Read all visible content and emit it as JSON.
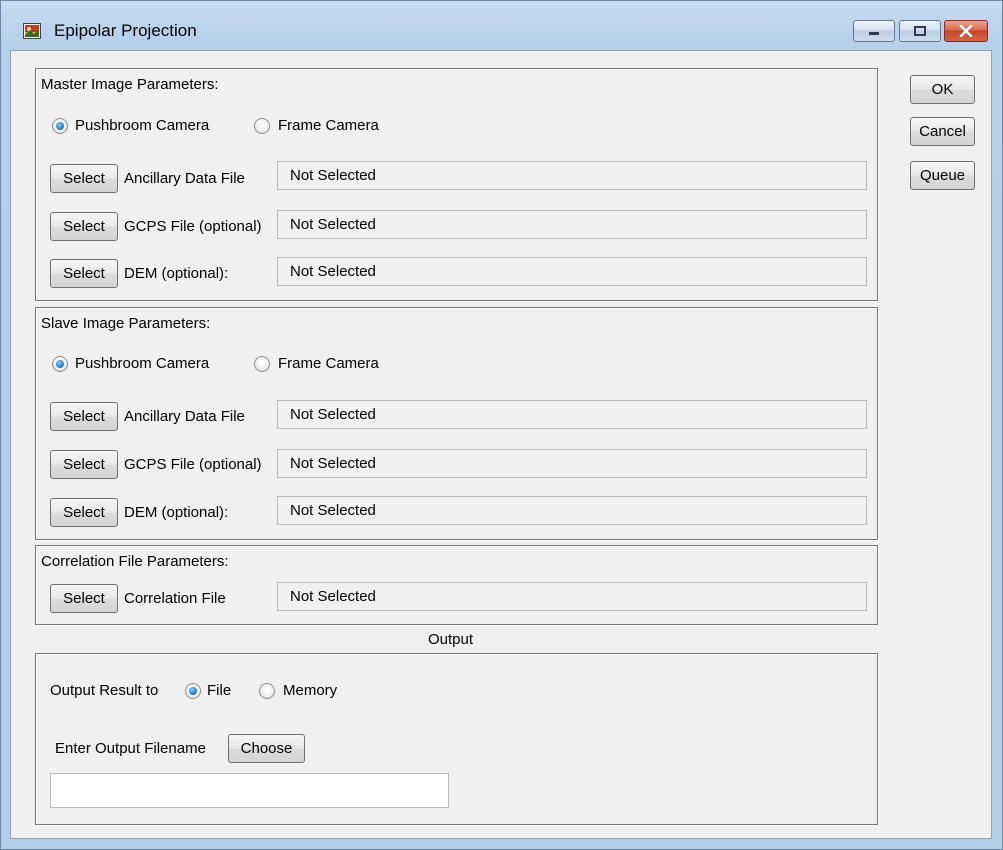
{
  "window": {
    "title": "Epipolar Projection",
    "controls": {
      "minimize": "minimize",
      "maximize": "maximize",
      "close": "close"
    }
  },
  "side_buttons": {
    "ok": "OK",
    "cancel": "Cancel",
    "queue": "Queue"
  },
  "master": {
    "title": "Master Image Parameters:",
    "camera_options": [
      "Pushbroom Camera",
      "Frame Camera"
    ],
    "selected_camera": "Pushbroom Camera",
    "rows": [
      {
        "button": "Select",
        "label": "Ancillary Data File",
        "value": "Not Selected"
      },
      {
        "button": "Select",
        "label": "GCPS File (optional)",
        "value": "Not Selected"
      },
      {
        "button": "Select",
        "label": "DEM (optional):",
        "value": "Not Selected"
      }
    ]
  },
  "slave": {
    "title": "Slave Image Parameters:",
    "camera_options": [
      "Pushbroom Camera",
      "Frame Camera"
    ],
    "selected_camera": "Pushbroom Camera",
    "rows": [
      {
        "button": "Select",
        "label": "Ancillary Data File",
        "value": "Not Selected"
      },
      {
        "button": "Select",
        "label": "GCPS File (optional)",
        "value": "Not Selected"
      },
      {
        "button": "Select",
        "label": "DEM (optional):",
        "value": "Not Selected"
      }
    ]
  },
  "correlation": {
    "title": "Correlation File Parameters:",
    "row": {
      "button": "Select",
      "label": "Correlation File",
      "value": "Not Selected"
    }
  },
  "output": {
    "title": "Output",
    "result_label": "Output Result to",
    "options": [
      "File",
      "Memory"
    ],
    "selected": "File",
    "filename_label": "Enter Output Filename",
    "choose_label": "Choose",
    "filename_value": ""
  },
  "colors": {
    "accent_radio": "#2a86cc",
    "close_button": "#c6452a",
    "title_bar": "#b9d1ea"
  }
}
